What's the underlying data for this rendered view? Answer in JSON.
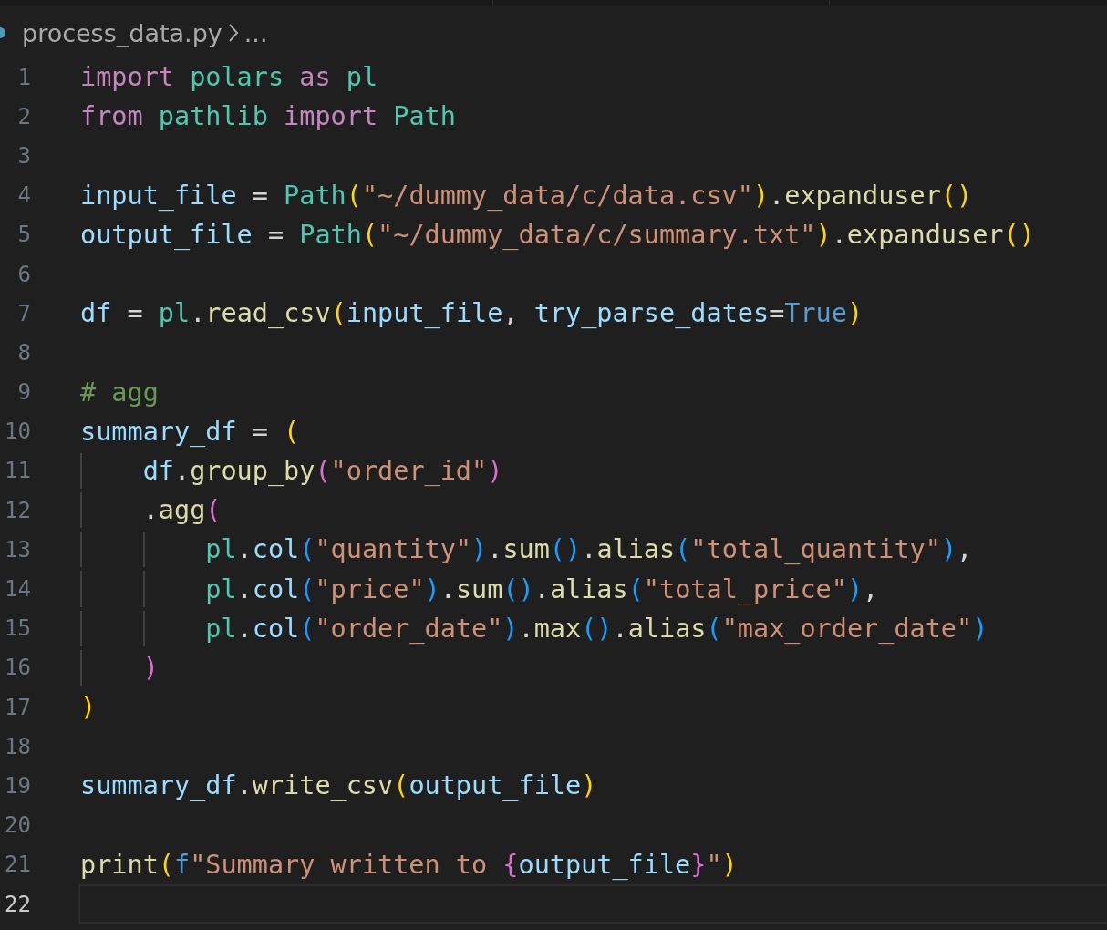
{
  "breadcrumb": {
    "file": "process_data.py",
    "more": "..."
  },
  "lines": [
    {
      "number": "1",
      "current": false,
      "text": "import polars as pl"
    },
    {
      "number": "2",
      "current": false,
      "text": "from pathlib import Path"
    },
    {
      "number": "3",
      "current": false
    },
    {
      "number": "4",
      "current": false,
      "text": "input_file = Path(\"~/dummy_data/c/data.csv\").expanduser()"
    },
    {
      "number": "5",
      "current": false,
      "text": "output_file = Path(\"~/dummy_data/c/summary.txt\").expanduser()"
    },
    {
      "number": "6",
      "current": false
    },
    {
      "number": "7",
      "current": false,
      "text": "df = pl.read_csv(input_file, try_parse_dates=True)"
    },
    {
      "number": "8",
      "current": false
    },
    {
      "number": "9",
      "current": false,
      "text": "# agg"
    },
    {
      "number": "10",
      "current": false,
      "text": "summary_df = ("
    },
    {
      "number": "11",
      "current": false,
      "text": "    df.group_by(\"order_id\")"
    },
    {
      "number": "12",
      "current": false,
      "text": "    .agg("
    },
    {
      "number": "13",
      "current": false,
      "text": "        pl.col(\"quantity\").sum().alias(\"total_quantity\"),"
    },
    {
      "number": "14",
      "current": false,
      "text": "        pl.col(\"price\").sum().alias(\"total_price\"),"
    },
    {
      "number": "15",
      "current": false,
      "text": "        pl.col(\"order_date\").max().alias(\"max_order_date\")"
    },
    {
      "number": "16",
      "current": false,
      "text": "    )"
    },
    {
      "number": "17",
      "current": false,
      "text": ")"
    },
    {
      "number": "18",
      "current": false
    },
    {
      "number": "19",
      "current": false,
      "text": "summary_df.write_csv(output_file)"
    },
    {
      "number": "20",
      "current": false
    },
    {
      "number": "21",
      "current": false,
      "text": "print(f\"Summary written to {output_file}\")"
    },
    {
      "number": "22",
      "current": true
    }
  ]
}
